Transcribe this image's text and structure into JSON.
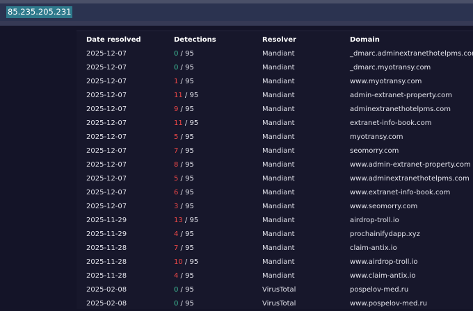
{
  "search": {
    "value": "85.235.205.231"
  },
  "colors": {
    "malicious": "#f04848",
    "clean": "#3fc29a"
  },
  "table": {
    "columns": [
      "Date resolved",
      "Detections",
      "Resolver",
      "Domain"
    ],
    "rows": [
      {
        "date": "2025-12-07",
        "detections": "0",
        "total": " / 95",
        "status": "green",
        "resolver": "Mandiant",
        "domain": "_dmarc.adminextranethotelpms.com"
      },
      {
        "date": "2025-12-07",
        "detections": "0",
        "total": " / 95",
        "status": "green",
        "resolver": "Mandiant",
        "domain": "_dmarc.myotransy.com"
      },
      {
        "date": "2025-12-07",
        "detections": "1",
        "total": " / 95",
        "status": "red",
        "resolver": "Mandiant",
        "domain": "www.myotransy.com"
      },
      {
        "date": "2025-12-07",
        "detections": "11",
        "total": " / 95",
        "status": "red",
        "resolver": "Mandiant",
        "domain": "admin-extranet-property.com"
      },
      {
        "date": "2025-12-07",
        "detections": "9",
        "total": " / 95",
        "status": "red",
        "resolver": "Mandiant",
        "domain": "adminextranethotelpms.com"
      },
      {
        "date": "2025-12-07",
        "detections": "11",
        "total": " / 95",
        "status": "red",
        "resolver": "Mandiant",
        "domain": "extranet-info-book.com"
      },
      {
        "date": "2025-12-07",
        "detections": "5",
        "total": " / 95",
        "status": "red",
        "resolver": "Mandiant",
        "domain": "myotransy.com"
      },
      {
        "date": "2025-12-07",
        "detections": "7",
        "total": " / 95",
        "status": "red",
        "resolver": "Mandiant",
        "domain": "seomorry.com"
      },
      {
        "date": "2025-12-07",
        "detections": "8",
        "total": " / 95",
        "status": "red",
        "resolver": "Mandiant",
        "domain": "www.admin-extranet-property.com"
      },
      {
        "date": "2025-12-07",
        "detections": "5",
        "total": " / 95",
        "status": "red",
        "resolver": "Mandiant",
        "domain": "www.adminextranethotelpms.com"
      },
      {
        "date": "2025-12-07",
        "detections": "6",
        "total": " / 95",
        "status": "red",
        "resolver": "Mandiant",
        "domain": "www.extranet-info-book.com"
      },
      {
        "date": "2025-12-07",
        "detections": "3",
        "total": " / 95",
        "status": "red",
        "resolver": "Mandiant",
        "domain": "www.seomorry.com"
      },
      {
        "date": "2025-11-29",
        "detections": "13",
        "total": " / 95",
        "status": "red",
        "resolver": "Mandiant",
        "domain": "airdrop-troll.io"
      },
      {
        "date": "2025-11-29",
        "detections": "4",
        "total": " / 95",
        "status": "red",
        "resolver": "Mandiant",
        "domain": "prochainifydapp.xyz"
      },
      {
        "date": "2025-11-28",
        "detections": "7",
        "total": " / 95",
        "status": "red",
        "resolver": "Mandiant",
        "domain": "claim-antix.io"
      },
      {
        "date": "2025-11-28",
        "detections": "10",
        "total": " / 95",
        "status": "red",
        "resolver": "Mandiant",
        "domain": "www.airdrop-troll.io"
      },
      {
        "date": "2025-11-28",
        "detections": "4",
        "total": " / 95",
        "status": "red",
        "resolver": "Mandiant",
        "domain": "www.claim-antix.io"
      },
      {
        "date": "2025-02-08",
        "detections": "0",
        "total": " / 95",
        "status": "green",
        "resolver": "VirusTotal",
        "domain": "pospelov-med.ru"
      },
      {
        "date": "2025-02-08",
        "detections": "0",
        "total": " / 95",
        "status": "green",
        "resolver": "VirusTotal",
        "domain": "www.pospelov-med.ru"
      }
    ]
  }
}
